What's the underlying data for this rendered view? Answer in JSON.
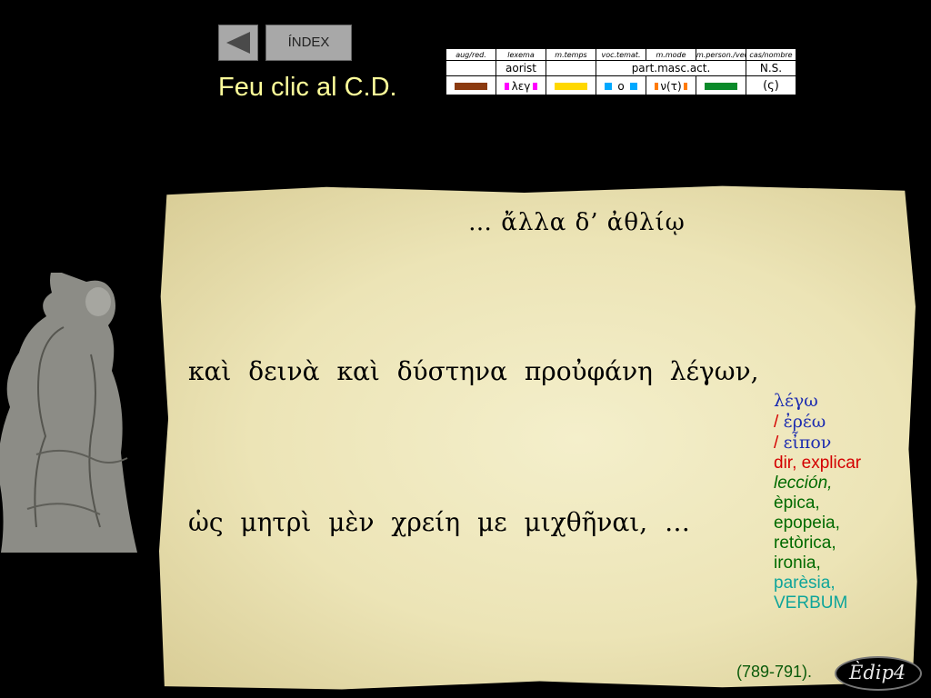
{
  "nav": {
    "index_label": "ÍNDEX",
    "back_icon": "back-arrow-icon"
  },
  "instruction": "Feu clic al C.D.",
  "morph_table": {
    "headers": [
      "aug/red.",
      "lexema",
      "m.temps",
      "voc.temat.",
      "m.mode",
      "m.person./veu",
      "cas/nombre"
    ],
    "values": [
      "aorist",
      "part.masc.act.",
      "N.S."
    ],
    "colors": [
      "#8b3a10",
      "#ff00ff",
      "#ffd800",
      "#00a8ff",
      "#ff7a00",
      "#0a8a2a"
    ],
    "lexeme": "λεγ",
    "thematic_vowel": "ο",
    "mood_marker": "ν(τ)",
    "ending": "(ς)"
  },
  "greek": {
    "line1": "… ἄλλα δ’ ἀθλίῳ",
    "line2": "καὶ δεινὰ καὶ δύστηνα προὐφάνη λέγων,",
    "line3": "ὡς μητρὶ μὲν χρείη με μιχθῆναι, …"
  },
  "notes": {
    "lemma1": "λέγω",
    "lemma2": "ἐρέω",
    "lemma3": "εἶπον",
    "slash": "/",
    "meaning_dir": "dir,",
    "meaning_explicar": "explicar",
    "derivatives": [
      "lección,",
      "èpica,",
      "epopeia,",
      "retòrica,",
      "ironia,",
      "parèsia,",
      "VERBUM"
    ]
  },
  "citation": "(789-791).",
  "badge": "Èdip4",
  "colors": {
    "instruction": "#ffff9a",
    "lemma": "#1b2bb0",
    "red": "#d40000",
    "green": "#006a00",
    "teal": "#0fa59a"
  }
}
